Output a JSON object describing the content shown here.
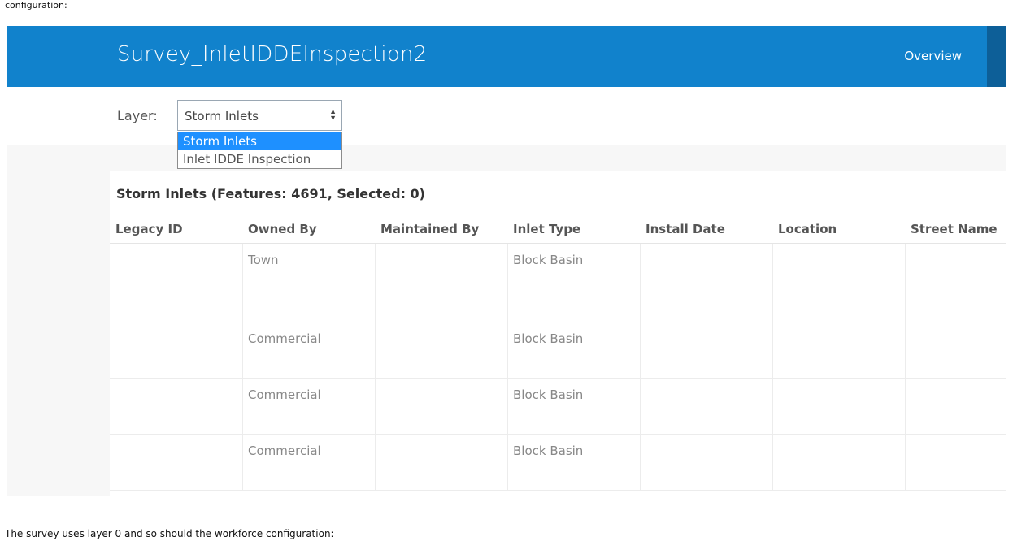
{
  "captions": {
    "top": "configuration:",
    "bottom": "The survey uses layer 0 and so should the workforce configuration:"
  },
  "header": {
    "title": "Survey_InletIDDEInspection2",
    "overview_label": "Overview",
    "bg_color": "#1182cc"
  },
  "layer_selector": {
    "label": "Layer:",
    "selected": "Storm Inlets",
    "options": [
      "Storm Inlets",
      "Inlet IDDE Inspection"
    ],
    "highlight_color": "#1e90ff"
  },
  "table": {
    "title": "Storm Inlets (Features: 4691, Selected: 0)",
    "columns": [
      "Legacy ID",
      "Owned By",
      "Maintained By",
      "Inlet Type",
      "Install Date",
      "Location",
      "Street Name"
    ],
    "rows": [
      [
        "",
        "Town",
        "",
        "Block Basin",
        "",
        "",
        ""
      ],
      [
        "",
        "Commercial",
        "",
        "Block Basin",
        "",
        "",
        ""
      ],
      [
        "",
        "Commercial",
        "",
        "Block Basin",
        "",
        "",
        ""
      ],
      [
        "",
        "Commercial",
        "",
        "Block Basin",
        "",
        "",
        ""
      ]
    ]
  }
}
